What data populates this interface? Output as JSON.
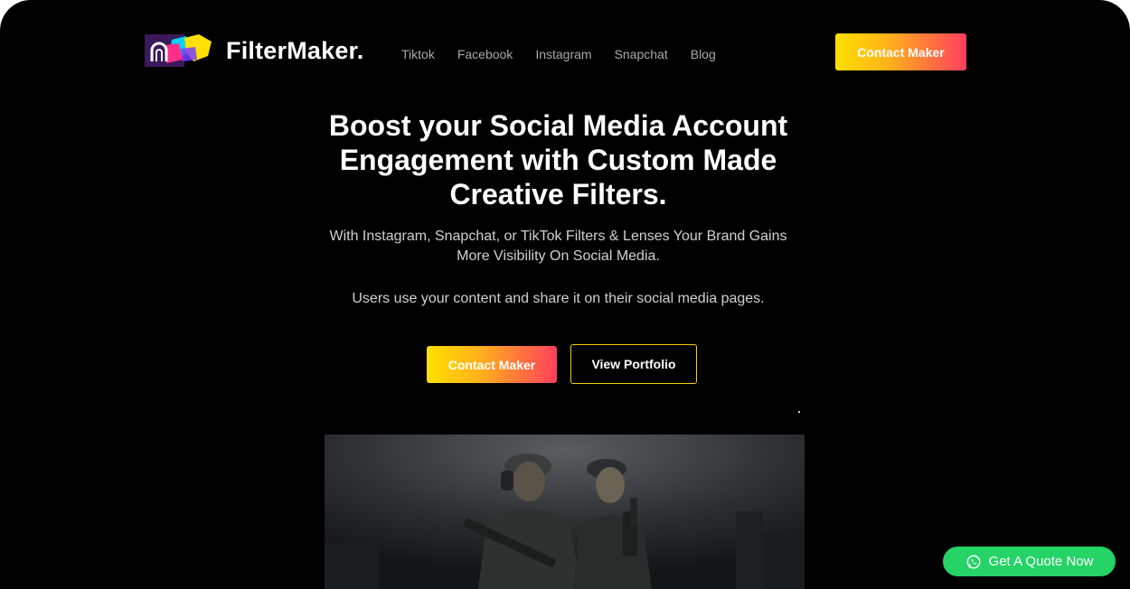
{
  "brand": {
    "name": "FilterMaker."
  },
  "nav": {
    "items": [
      "Tiktok",
      "Facebook",
      "Instagram",
      "Snapchat",
      "Blog"
    ]
  },
  "header": {
    "cta_label": "Contact Maker"
  },
  "hero": {
    "title": "Boost your Social Media Account Engagement with Custom Made Creative Filters.",
    "subtitle": "With Instagram, Snapchat, or TikTok Filters & Lenses Your Brand Gains More Visibility On Social Media.",
    "subtitle2": "Users use your content and share it on their social media pages.",
    "primary_label": "Contact Maker",
    "secondary_label": "View Portfolio"
  },
  "floating": {
    "quote_label": "Get A Quote Now"
  },
  "colors": {
    "background": "#000000",
    "gradient_start": "#ffe000",
    "gradient_end": "#ff3f5c",
    "outline": "#f3d100",
    "whatsapp": "#25d366"
  }
}
